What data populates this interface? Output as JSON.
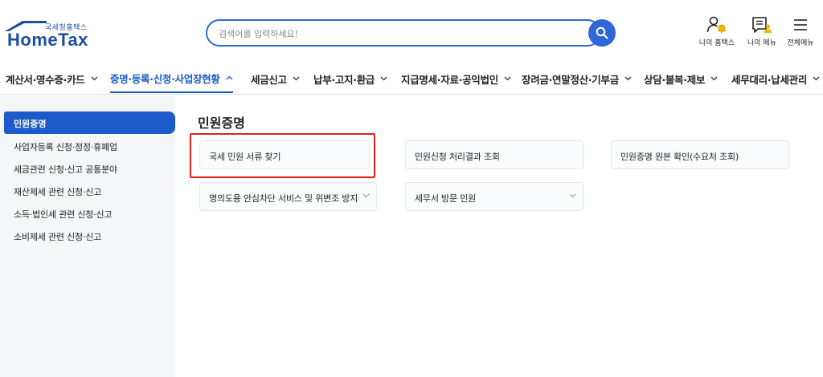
{
  "logo": {
    "sub_text": "국세청홈택스",
    "main_text": "HomeTax"
  },
  "search": {
    "placeholder": "검색어를 입력하세요!"
  },
  "utility": {
    "my_hometax": "나의 홈택스",
    "my_menu": "나의 메뉴",
    "all_menu": "전체메뉴"
  },
  "nav": {
    "items": [
      {
        "label": "계산서·영수증·카드"
      },
      {
        "label": "증명·등록·신청·사업장현황"
      },
      {
        "label": "세금신고"
      },
      {
        "label": "납부·고지·환급"
      },
      {
        "label": "지급명세·자료·공익법인"
      },
      {
        "label": "장려금·연말정산·기부금"
      },
      {
        "label": "상담·불복·제보"
      },
      {
        "label": "세무대리·납세관리"
      }
    ]
  },
  "sidebar": {
    "items": [
      {
        "label": "민원증명",
        "active": true
      },
      {
        "label": "사업자등록 신청·정정·휴폐업"
      },
      {
        "label": "세금관련 신청·신고 공통분야"
      },
      {
        "label": "재산제세 관련 신청·신고"
      },
      {
        "label": "소득·법인세 관련 신청·신고"
      },
      {
        "label": "소비제세 관련 신청·신고"
      }
    ]
  },
  "main": {
    "title": "민원증명",
    "cards": [
      {
        "label": "국세 민원 서류 찾기",
        "highlighted": true
      },
      {
        "label": "민원신청 처리결과 조회"
      },
      {
        "label": "민원증명 원본 확인(수요처 조회)"
      },
      {
        "label": "명의도용 안심차단 서비스 및 위변조 방지",
        "expandable": true
      },
      {
        "label": "세무서 방문 민원",
        "expandable": true
      }
    ]
  },
  "colors": {
    "brand_blue": "#1c5bc9",
    "search_blue": "#2f66d8",
    "highlight_red": "#e0201f",
    "sidebar_bg": "#f4f6f8"
  },
  "icons": {
    "search": "search-icon",
    "my_hometax": "user-bell-icon",
    "my_menu": "document-user-icon",
    "all_menu": "hamburger-icon",
    "dropdown": "chevron-down-icon",
    "collapse": "chevron-up-icon"
  }
}
